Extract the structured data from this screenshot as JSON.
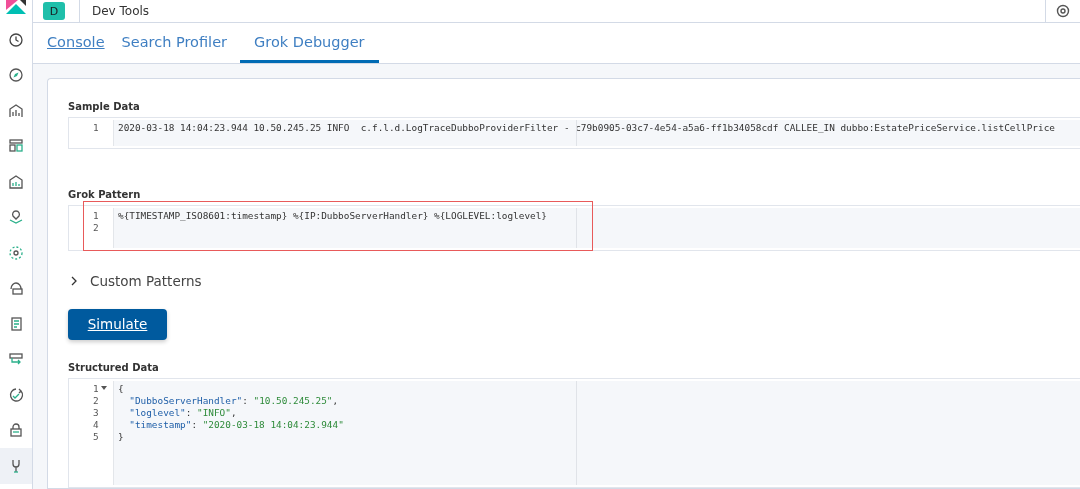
{
  "header": {
    "app_badge": "D",
    "title": "Dev Tools"
  },
  "sidebar": {
    "items": [
      {
        "selected": false
      },
      {
        "selected": false
      },
      {
        "selected": false
      },
      {
        "selected": false
      },
      {
        "selected": false
      },
      {
        "selected": false
      },
      {
        "selected": false
      },
      {
        "selected": false
      },
      {
        "selected": false
      },
      {
        "selected": false
      },
      {
        "selected": false
      },
      {
        "selected": false
      },
      {
        "selected": true
      }
    ]
  },
  "tabs": [
    {
      "label": "Console",
      "selected": false,
      "underlined": true
    },
    {
      "label": "Search Profiler",
      "selected": false,
      "underlined": false
    },
    {
      "label": "Grok Debugger",
      "selected": true,
      "underlined": false
    }
  ],
  "sample_data": {
    "label": "Sample Data",
    "lines": [
      {
        "number": "1",
        "text": "2020-03-18 14:04:23.944 10.50.245.25 INFO  c.f.l.d.LogTraceDubboProviderFilter - c79b0905-03c7-4e54-a5a6-ff1b34058cdf CALLEE_IN dubbo:EstatePriceService.listCellPrice"
      }
    ]
  },
  "grok_pattern": {
    "label": "Grok Pattern",
    "highlighted": true,
    "lines": [
      {
        "number": "1",
        "text": "%{TIMESTAMP_ISO8601:timestamp} %{IP:DubboServerHandler} %{LOGLEVEL:loglevel}"
      },
      {
        "number": "2"
      }
    ]
  },
  "custom_patterns": {
    "label": "Custom Patterns",
    "expanded": false
  },
  "simulate_button": {
    "label": "Simulate"
  },
  "structured_data": {
    "label": "Structured Data",
    "lines": [
      {
        "number": "1",
        "foldable": true,
        "tokens": [
          {
            "kind": "punct",
            "text": "{"
          }
        ]
      },
      {
        "number": "2",
        "foldable": false,
        "tokens": [
          {
            "kind": "key",
            "text": "  \"DubboServerHandler\""
          },
          {
            "kind": "punct",
            "text": ": "
          },
          {
            "kind": "string",
            "text": "\"10.50.245.25\""
          },
          {
            "kind": "punct",
            "text": ","
          }
        ]
      },
      {
        "number": "3",
        "foldable": false,
        "tokens": [
          {
            "kind": "key",
            "text": "  \"loglevel\""
          },
          {
            "kind": "punct",
            "text": ": "
          },
          {
            "kind": "string",
            "text": "\"INFO\""
          },
          {
            "kind": "punct",
            "text": ","
          }
        ]
      },
      {
        "number": "4",
        "foldable": false,
        "tokens": [
          {
            "kind": "key",
            "text": "  \"timestamp\""
          },
          {
            "kind": "punct",
            "text": ": "
          },
          {
            "kind": "string",
            "text": "\"2020-03-18 14:04:23.944\""
          }
        ]
      },
      {
        "number": "5",
        "foldable": false,
        "tokens": [
          {
            "kind": "punct",
            "text": "}"
          }
        ]
      }
    ]
  }
}
